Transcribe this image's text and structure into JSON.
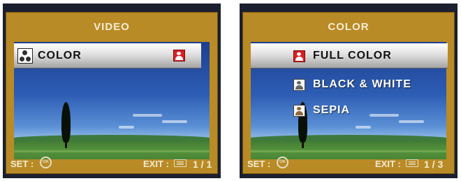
{
  "left_screen": {
    "title": "VIDEO",
    "menu_item": {
      "label": "COLOR",
      "icon": "color-effect-icon",
      "value_icon": "full-color-icon"
    },
    "footer": {
      "set_label": "SET :",
      "ok_icon": "ok-button-icon",
      "ok_text": "OK",
      "exit_label": "EXIT :",
      "menu_icon": "menu-button-icon",
      "page": "1 / 1"
    }
  },
  "right_screen": {
    "title": "COLOR",
    "options": [
      {
        "label": "FULL COLOR",
        "icon": "full-color-icon",
        "selected": true
      },
      {
        "label": "BLACK & WHITE",
        "icon": "black-white-icon",
        "selected": false
      },
      {
        "label": "SEPIA",
        "icon": "sepia-icon",
        "selected": false
      }
    ],
    "footer": {
      "set_label": "SET :",
      "ok_icon": "ok-button-icon",
      "ok_text": "OK",
      "exit_label": "EXIT :",
      "menu_icon": "menu-button-icon",
      "page": "1 / 3"
    }
  },
  "colors": {
    "frame": "#b98b26",
    "highlight": "#e0e0e0",
    "full_color_icon": "#d81f24",
    "label_text": "#f4ecd4"
  }
}
